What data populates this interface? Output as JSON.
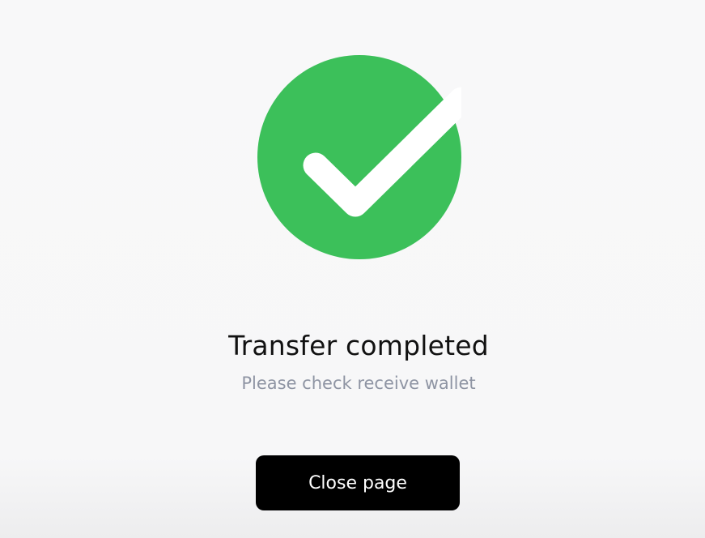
{
  "status": {
    "icon": "check-circle-icon",
    "title": "Transfer completed",
    "subtitle": "Please check receive wallet"
  },
  "actions": {
    "close_label": "Close page"
  },
  "colors": {
    "success": "#3cc05a",
    "button_bg": "#000000",
    "subtitle_text": "#8e94a3"
  }
}
